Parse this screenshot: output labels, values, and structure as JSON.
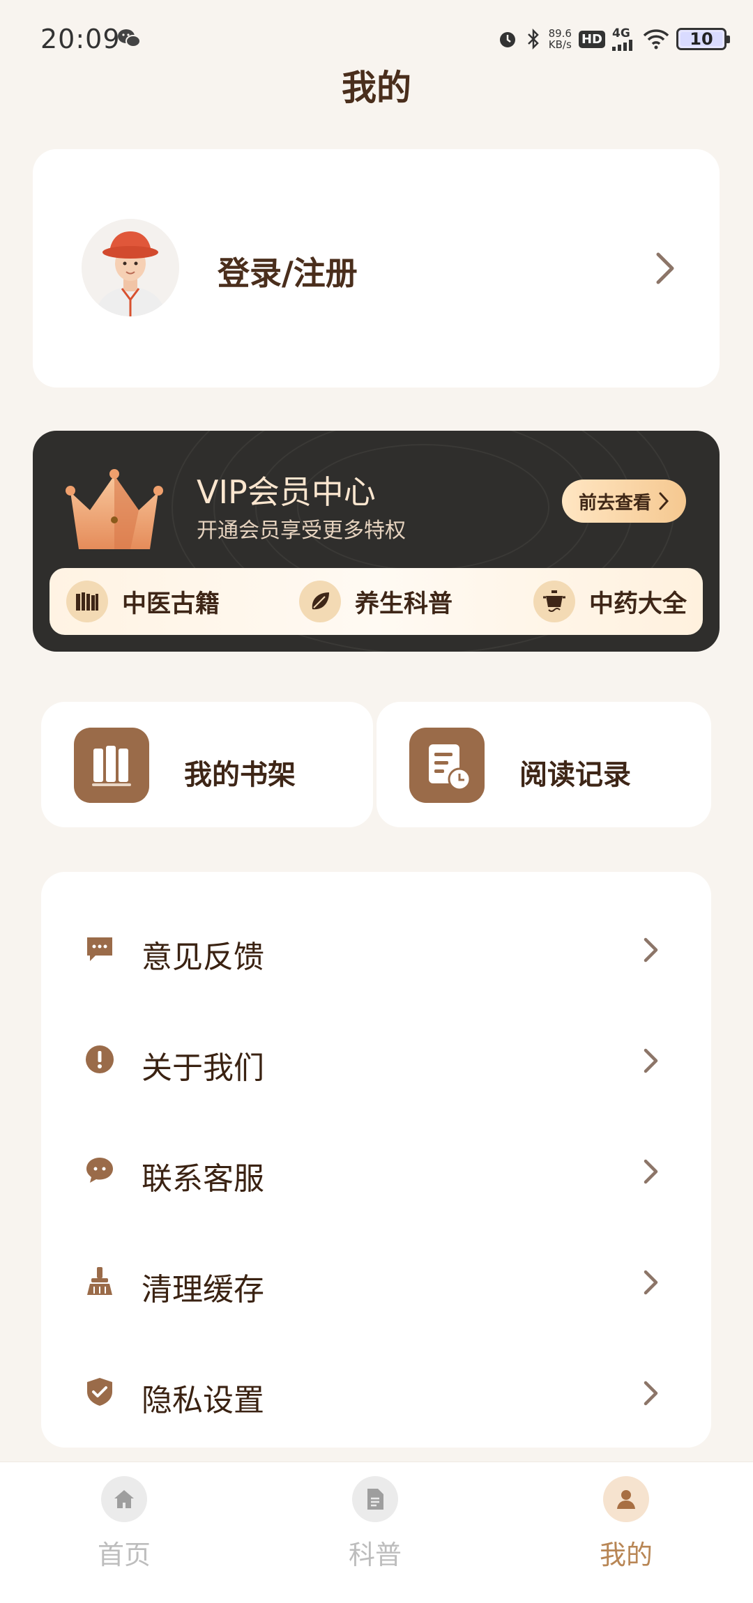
{
  "status_bar": {
    "time": "20:09",
    "speed_value": "89.6",
    "speed_unit": "KB/s",
    "hd": "HD",
    "network": "4G",
    "battery": "10"
  },
  "page_title": "我的",
  "login": {
    "label": "登录/注册"
  },
  "vip": {
    "title": "VIP会员中心",
    "subtitle": "开通会员享受更多特权",
    "button": "前去查看",
    "features": [
      {
        "label": "中医古籍",
        "icon": "books-icon"
      },
      {
        "label": "养生科普",
        "icon": "leaf-icon"
      },
      {
        "label": "中药大全",
        "icon": "pot-icon"
      }
    ]
  },
  "tiles": [
    {
      "label": "我的书架",
      "icon": "bookshelf-icon"
    },
    {
      "label": "阅读记录",
      "icon": "reading-history-icon"
    }
  ],
  "menu": [
    {
      "label": "意见反馈",
      "icon": "feedback-icon"
    },
    {
      "label": "关于我们",
      "icon": "info-icon"
    },
    {
      "label": "联系客服",
      "icon": "chat-icon"
    },
    {
      "label": "清理缓存",
      "icon": "broom-icon"
    },
    {
      "label": "隐私设置",
      "icon": "shield-icon"
    }
  ],
  "tab_bar": {
    "active": "我的",
    "tabs": [
      {
        "label": "首页",
        "icon": "home-icon"
      },
      {
        "label": "科普",
        "icon": "document-icon"
      },
      {
        "label": "我的",
        "icon": "user-icon"
      }
    ]
  },
  "colors": {
    "background": "#f8f4ef",
    "accent_brown": "#9a6b49",
    "vip_dark": "#2f2e2c",
    "vip_gold": "#f5c890",
    "tab_active": "#b88655"
  }
}
